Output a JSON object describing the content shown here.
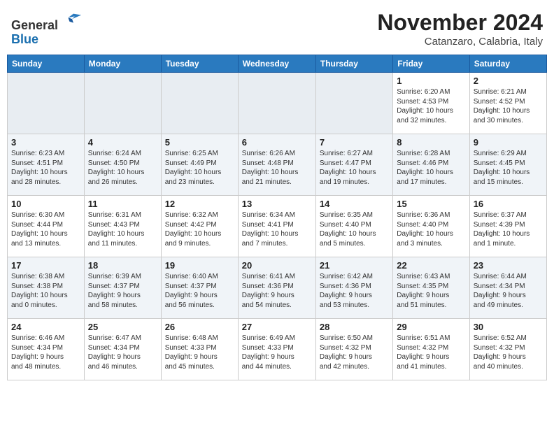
{
  "header": {
    "logo_line1": "General",
    "logo_line2": "Blue",
    "month": "November 2024",
    "location": "Catanzaro, Calabria, Italy"
  },
  "days_of_week": [
    "Sunday",
    "Monday",
    "Tuesday",
    "Wednesday",
    "Thursday",
    "Friday",
    "Saturday"
  ],
  "weeks": [
    [
      {
        "num": "",
        "info": ""
      },
      {
        "num": "",
        "info": ""
      },
      {
        "num": "",
        "info": ""
      },
      {
        "num": "",
        "info": ""
      },
      {
        "num": "",
        "info": ""
      },
      {
        "num": "1",
        "info": "Sunrise: 6:20 AM\nSunset: 4:53 PM\nDaylight: 10 hours\nand 32 minutes."
      },
      {
        "num": "2",
        "info": "Sunrise: 6:21 AM\nSunset: 4:52 PM\nDaylight: 10 hours\nand 30 minutes."
      }
    ],
    [
      {
        "num": "3",
        "info": "Sunrise: 6:23 AM\nSunset: 4:51 PM\nDaylight: 10 hours\nand 28 minutes."
      },
      {
        "num": "4",
        "info": "Sunrise: 6:24 AM\nSunset: 4:50 PM\nDaylight: 10 hours\nand 26 minutes."
      },
      {
        "num": "5",
        "info": "Sunrise: 6:25 AM\nSunset: 4:49 PM\nDaylight: 10 hours\nand 23 minutes."
      },
      {
        "num": "6",
        "info": "Sunrise: 6:26 AM\nSunset: 4:48 PM\nDaylight: 10 hours\nand 21 minutes."
      },
      {
        "num": "7",
        "info": "Sunrise: 6:27 AM\nSunset: 4:47 PM\nDaylight: 10 hours\nand 19 minutes."
      },
      {
        "num": "8",
        "info": "Sunrise: 6:28 AM\nSunset: 4:46 PM\nDaylight: 10 hours\nand 17 minutes."
      },
      {
        "num": "9",
        "info": "Sunrise: 6:29 AM\nSunset: 4:45 PM\nDaylight: 10 hours\nand 15 minutes."
      }
    ],
    [
      {
        "num": "10",
        "info": "Sunrise: 6:30 AM\nSunset: 4:44 PM\nDaylight: 10 hours\nand 13 minutes."
      },
      {
        "num": "11",
        "info": "Sunrise: 6:31 AM\nSunset: 4:43 PM\nDaylight: 10 hours\nand 11 minutes."
      },
      {
        "num": "12",
        "info": "Sunrise: 6:32 AM\nSunset: 4:42 PM\nDaylight: 10 hours\nand 9 minutes."
      },
      {
        "num": "13",
        "info": "Sunrise: 6:34 AM\nSunset: 4:41 PM\nDaylight: 10 hours\nand 7 minutes."
      },
      {
        "num": "14",
        "info": "Sunrise: 6:35 AM\nSunset: 4:40 PM\nDaylight: 10 hours\nand 5 minutes."
      },
      {
        "num": "15",
        "info": "Sunrise: 6:36 AM\nSunset: 4:40 PM\nDaylight: 10 hours\nand 3 minutes."
      },
      {
        "num": "16",
        "info": "Sunrise: 6:37 AM\nSunset: 4:39 PM\nDaylight: 10 hours\nand 1 minute."
      }
    ],
    [
      {
        "num": "17",
        "info": "Sunrise: 6:38 AM\nSunset: 4:38 PM\nDaylight: 10 hours\nand 0 minutes."
      },
      {
        "num": "18",
        "info": "Sunrise: 6:39 AM\nSunset: 4:37 PM\nDaylight: 9 hours\nand 58 minutes."
      },
      {
        "num": "19",
        "info": "Sunrise: 6:40 AM\nSunset: 4:37 PM\nDaylight: 9 hours\nand 56 minutes."
      },
      {
        "num": "20",
        "info": "Sunrise: 6:41 AM\nSunset: 4:36 PM\nDaylight: 9 hours\nand 54 minutes."
      },
      {
        "num": "21",
        "info": "Sunrise: 6:42 AM\nSunset: 4:36 PM\nDaylight: 9 hours\nand 53 minutes."
      },
      {
        "num": "22",
        "info": "Sunrise: 6:43 AM\nSunset: 4:35 PM\nDaylight: 9 hours\nand 51 minutes."
      },
      {
        "num": "23",
        "info": "Sunrise: 6:44 AM\nSunset: 4:34 PM\nDaylight: 9 hours\nand 49 minutes."
      }
    ],
    [
      {
        "num": "24",
        "info": "Sunrise: 6:46 AM\nSunset: 4:34 PM\nDaylight: 9 hours\nand 48 minutes."
      },
      {
        "num": "25",
        "info": "Sunrise: 6:47 AM\nSunset: 4:34 PM\nDaylight: 9 hours\nand 46 minutes."
      },
      {
        "num": "26",
        "info": "Sunrise: 6:48 AM\nSunset: 4:33 PM\nDaylight: 9 hours\nand 45 minutes."
      },
      {
        "num": "27",
        "info": "Sunrise: 6:49 AM\nSunset: 4:33 PM\nDaylight: 9 hours\nand 44 minutes."
      },
      {
        "num": "28",
        "info": "Sunrise: 6:50 AM\nSunset: 4:32 PM\nDaylight: 9 hours\nand 42 minutes."
      },
      {
        "num": "29",
        "info": "Sunrise: 6:51 AM\nSunset: 4:32 PM\nDaylight: 9 hours\nand 41 minutes."
      },
      {
        "num": "30",
        "info": "Sunrise: 6:52 AM\nSunset: 4:32 PM\nDaylight: 9 hours\nand 40 minutes."
      }
    ]
  ]
}
